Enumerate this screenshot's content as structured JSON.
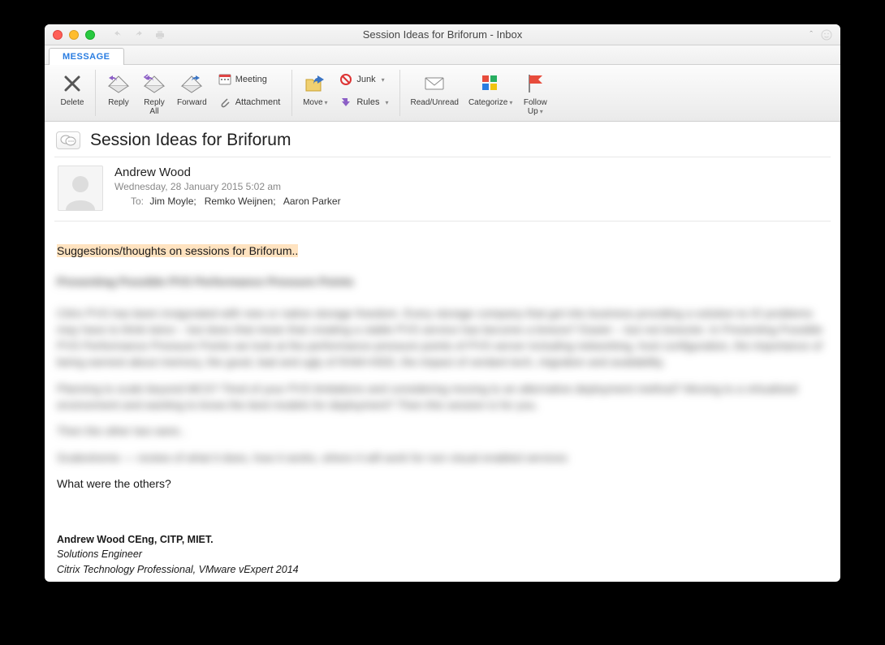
{
  "window": {
    "title": "Session Ideas for Briforum - Inbox"
  },
  "tabs": {
    "message": "MESSAGE"
  },
  "ribbon": {
    "delete": "Delete",
    "reply": "Reply",
    "reply_all": "Reply\nAll",
    "forward": "Forward",
    "meeting": "Meeting",
    "attachment": "Attachment",
    "move": "Move",
    "junk": "Junk",
    "rules": "Rules",
    "read_unread": "Read/Unread",
    "categorize": "Categorize",
    "follow_up": "Follow\nUp"
  },
  "email": {
    "subject": "Session Ideas for Briforum",
    "sender": "Andrew Wood",
    "date": "Wednesday, 28 January 2015 5:02 am",
    "to_label": "To:",
    "recipients": [
      "Jim Moyle;",
      "Remko Weijnen;",
      "Aaron Parker"
    ],
    "first_line": "Suggestions/thoughts on sessions for Briforum..",
    "question": "What were the others?",
    "signature": {
      "name_line": "Andrew Wood CEng, CITP, MIET.",
      "title": "Solutions Engineer",
      "creds": "Citrix Technology Professional, VMware vExpert 2014"
    },
    "blurred": {
      "p1": "Presenting Possible PVS Performance Pressure Points",
      "p2": "Citrix PVS has been invigorated with new or native storage freedom. Every storage company that got into business providing a solution to IO problems may have to think twice – but does that mean that creating a viable PVS service has become a breeze? Easier – but not breezier. In Presenting Possible PVS Performance Pressure Points we look at the performance pressure points of PVS server including networking, host configuration, the importance of being earnest about memory, the good, bad and ugly of RAM+HDD, the impact of verdant tech, migration and availability.",
      "p3": "Planning to scale beyond MCS? Tired of your PVS limitations and considering moving to an alternative deployment method? Moving to a virtualised environment and wanting to know the best models for deployment? Then this session is for you.",
      "p4": "Then the other two were..",
      "p5": "Scalextreme — review of what it does, how it works, where it will work for non visual enabled services"
    }
  }
}
